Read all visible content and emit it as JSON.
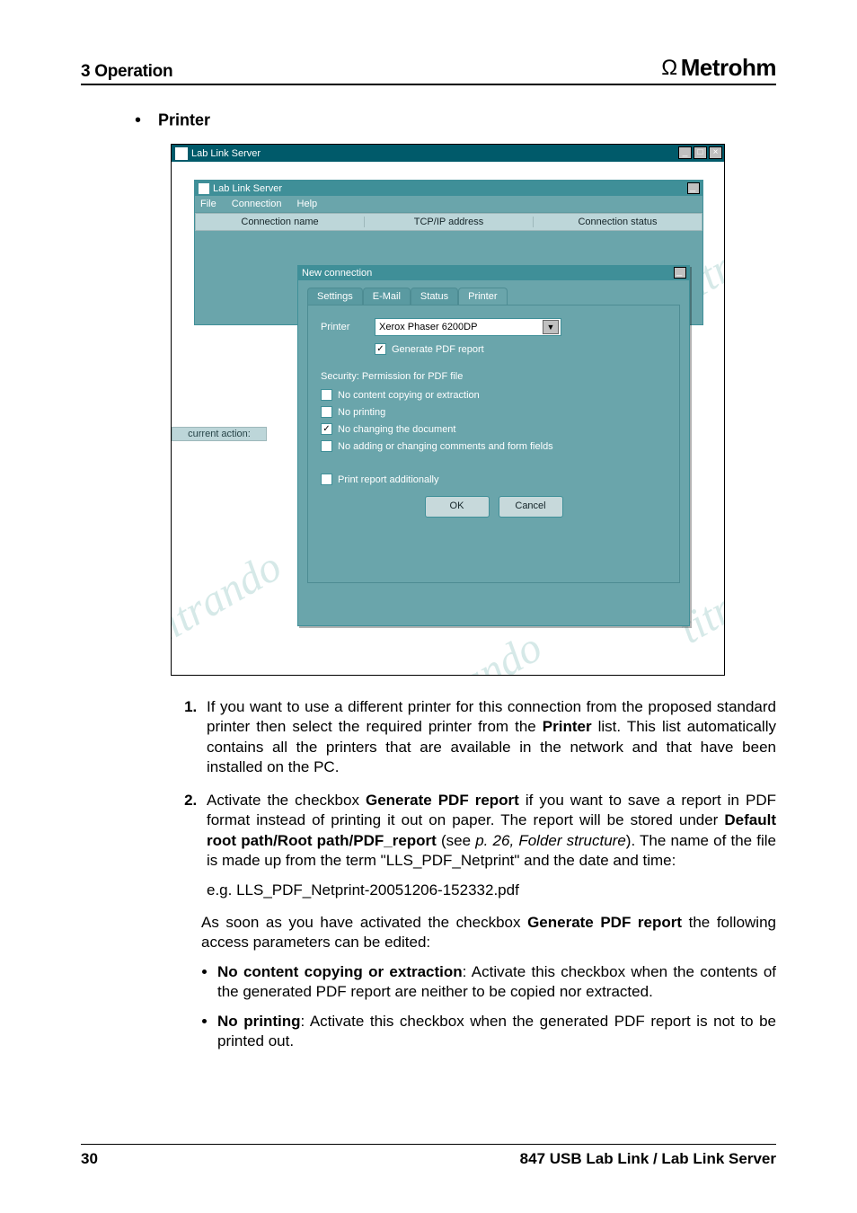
{
  "header": {
    "section": "3 Operation",
    "brand": "Metrohm",
    "brand_symbol": "Ω"
  },
  "bullet": {
    "label": "Printer"
  },
  "screenshot": {
    "outer_title": "Lab Link Server",
    "inner_title": "Lab Link Server",
    "menus": {
      "file": "File",
      "connection": "Connection",
      "help": "Help"
    },
    "columns": {
      "name": "Connection name",
      "ip": "TCP/IP address",
      "status": "Connection status"
    },
    "current_action_label": "current action:",
    "dialog_title": "New connection",
    "tabs": {
      "settings": "Settings",
      "email": "E-Mail",
      "status": "Status",
      "printer": "Printer"
    },
    "printer_label": "Printer",
    "printer_value": "Xerox Phaser 6200DP",
    "generate_pdf": "Generate PDF report",
    "security_heading": "Security: Permission for PDF file",
    "opts": {
      "no_copy": "No content copying or extraction",
      "no_print": "No printing",
      "no_change": "No changing the document",
      "no_comments": "No adding or changing comments and form fields"
    },
    "print_additional": "Print report additionally",
    "ok": "OK",
    "cancel": "Cancel",
    "watermark": "titrando"
  },
  "body": {
    "item1_a": "If you want to use a different printer for this connection from the proposed standard printer then select the required printer from the ",
    "item1_b": "Printer",
    "item1_c": " list. This list automatically contains all the printers that are available in the network and that have been installed on the PC.",
    "item2_a": "Activate the checkbox ",
    "item2_b": "Generate PDF report",
    "item2_c": " if you want to save a report in PDF format instead of printing it out on paper. The report will be stored under ",
    "item2_d": "Default root path/Root path/PDF_report",
    "item2_e": " (see ",
    "item2_f": "p. 26, Folder structure",
    "item2_g": "). The name of the file is made up from the term \"LLS_PDF_Netprint\" and the date and time:",
    "example": "e.g. LLS_PDF_Netprint-20051206-152332.pdf",
    "para_a": "As soon as you have activated the checkbox ",
    "para_b": "Generate PDF report",
    "para_c": " the following access parameters can be edited:",
    "sb1_a": "No content copying or extraction",
    "sb1_b": ": Activate this checkbox when the contents of the generated PDF report are neither to be copied nor extracted.",
    "sb2_a": "No printing",
    "sb2_b": ": Activate this checkbox when the generated PDF report is not to be printed out."
  },
  "footer": {
    "page": "30",
    "product": "847 USB Lab Link / Lab Link Server"
  }
}
